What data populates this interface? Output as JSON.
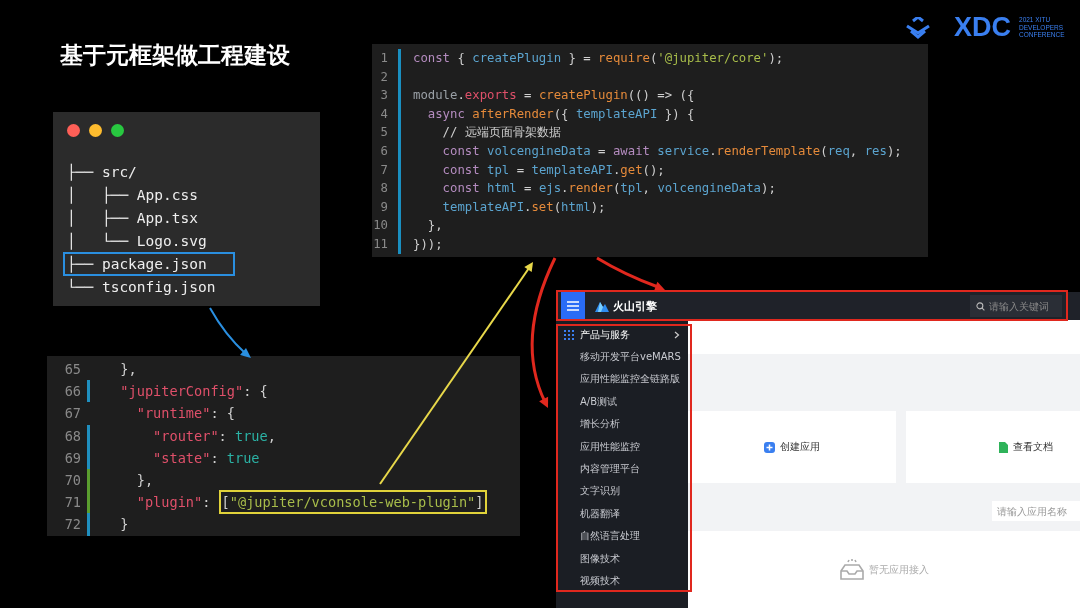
{
  "title": "基于元框架做工程建设",
  "logo": {
    "wordmark": "XDC",
    "lines": [
      "2021 XITU",
      "DEVELOPERS",
      "CONFERENCE"
    ]
  },
  "code_editor": {
    "lines": [
      {
        "number": "1",
        "tokens": [
          {
            "kind": "kw",
            "t": "const "
          },
          {
            "kind": "p",
            "t": "{ "
          },
          {
            "kind": "var",
            "t": "createPlugin"
          },
          {
            "kind": "p",
            "t": " } = "
          },
          {
            "kind": "fn",
            "t": "require"
          },
          {
            "kind": "p",
            "t": "("
          },
          {
            "kind": "str",
            "t": "'@jupiter/core'"
          },
          {
            "kind": "p",
            "t": ");"
          }
        ]
      },
      {
        "number": "2"
      },
      {
        "number": "3",
        "tokens": [
          {
            "kind": "plain",
            "t": "module"
          },
          {
            "kind": "p",
            "t": "."
          },
          {
            "kind": "prop",
            "t": "exports"
          },
          {
            "kind": "p",
            "t": " = "
          },
          {
            "kind": "fn",
            "t": "createPlugin"
          },
          {
            "kind": "p",
            "t": "(() => ({"
          }
        ]
      },
      {
        "number": "4",
        "tokens": [
          {
            "kind": "kw",
            "t": "  async "
          },
          {
            "kind": "fn",
            "t": "afterRender"
          },
          {
            "kind": "p",
            "t": "({ "
          },
          {
            "kind": "var",
            "t": "templateAPI"
          },
          {
            "kind": "p",
            "t": " }) {"
          }
        ]
      },
      {
        "number": "5",
        "tokens": [
          {
            "kind": "cmt",
            "t": "    // 远端页面骨架数据"
          }
        ]
      },
      {
        "number": "6",
        "tokens": [
          {
            "kind": "kw",
            "t": "    const "
          },
          {
            "kind": "var",
            "t": "volcengineData"
          },
          {
            "kind": "p",
            "t": " = "
          },
          {
            "kind": "kw",
            "t": "await "
          },
          {
            "kind": "var",
            "t": "service"
          },
          {
            "kind": "p",
            "t": "."
          },
          {
            "kind": "fn",
            "t": "renderTemplate"
          },
          {
            "kind": "p",
            "t": "("
          },
          {
            "kind": "var",
            "t": "req"
          },
          {
            "kind": "p",
            "t": ", "
          },
          {
            "kind": "var",
            "t": "res"
          },
          {
            "kind": "p",
            "t": ");"
          }
        ]
      },
      {
        "number": "7",
        "tokens": [
          {
            "kind": "kw",
            "t": "    const "
          },
          {
            "kind": "var",
            "t": "tpl"
          },
          {
            "kind": "p",
            "t": " = "
          },
          {
            "kind": "var",
            "t": "templateAPI"
          },
          {
            "kind": "p",
            "t": "."
          },
          {
            "kind": "fn",
            "t": "get"
          },
          {
            "kind": "p",
            "t": "();"
          }
        ]
      },
      {
        "number": "8",
        "tokens": [
          {
            "kind": "kw",
            "t": "    const "
          },
          {
            "kind": "var",
            "t": "html"
          },
          {
            "kind": "p",
            "t": " = "
          },
          {
            "kind": "var",
            "t": "ejs"
          },
          {
            "kind": "p",
            "t": "."
          },
          {
            "kind": "fn",
            "t": "render"
          },
          {
            "kind": "p",
            "t": "("
          },
          {
            "kind": "var",
            "t": "tpl"
          },
          {
            "kind": "p",
            "t": ", "
          },
          {
            "kind": "var",
            "t": "volcengineData"
          },
          {
            "kind": "p",
            "t": ");"
          }
        ]
      },
      {
        "number": "9",
        "tokens": [
          {
            "kind": "var",
            "t": "    templateAPI"
          },
          {
            "kind": "p",
            "t": "."
          },
          {
            "kind": "fn",
            "t": "set"
          },
          {
            "kind": "p",
            "t": "("
          },
          {
            "kind": "var",
            "t": "html"
          },
          {
            "kind": "p",
            "t": ");"
          }
        ]
      },
      {
        "number": "10",
        "tokens": [
          {
            "kind": "p",
            "t": "  },"
          }
        ]
      },
      {
        "number": "11",
        "tokens": [
          {
            "kind": "p",
            "t": "}));"
          }
        ]
      }
    ]
  },
  "file_tree": {
    "lines": [
      {
        "text": "├── src/",
        "boxed": false
      },
      {
        "text": "│   ├── App.css",
        "boxed": false
      },
      {
        "text": "│   ├── App.tsx",
        "boxed": false
      },
      {
        "text": "│   └── Logo.svg",
        "boxed": false
      },
      {
        "text": "├── package.json",
        "boxed": true
      },
      {
        "text": "└── tsconfig.json",
        "boxed": false
      }
    ]
  },
  "config_editor": {
    "lines": [
      {
        "number": "65",
        "tokens": [
          {
            "kind": "p",
            "t": "  },"
          }
        ]
      },
      {
        "number": "66",
        "color": "#1f8fbf",
        "tokens": [
          {
            "kind": "key",
            "t": "  \"jupiterConfig\""
          },
          {
            "kind": "p",
            "t": ": {"
          }
        ]
      },
      {
        "number": "67",
        "tokens": [
          {
            "kind": "key",
            "t": "    \"runtime\""
          },
          {
            "kind": "p",
            "t": ": {"
          }
        ]
      },
      {
        "number": "68",
        "color": "#1f8fbf",
        "tokens": [
          {
            "kind": "key",
            "t": "      \"router\""
          },
          {
            "kind": "p",
            "t": ": "
          },
          {
            "kind": "bool",
            "t": "true"
          },
          {
            "kind": "p",
            "t": ","
          }
        ]
      },
      {
        "number": "69",
        "color": "#1f8fbf",
        "tokens": [
          {
            "kind": "key",
            "t": "      \"state\""
          },
          {
            "kind": "p",
            "t": ": "
          },
          {
            "kind": "bool",
            "t": "true"
          }
        ]
      },
      {
        "number": "70",
        "color": "#5a9e2f",
        "tokens": [
          {
            "kind": "p",
            "t": "    },"
          }
        ]
      },
      {
        "number": "71",
        "color": "#5a9e2f",
        "tokens": [
          {
            "kind": "key",
            "t": "    \"plugin\""
          },
          {
            "kind": "p",
            "t": ": "
          },
          {
            "kind": "p",
            "t": "[",
            "boxed": true
          },
          {
            "kind": "str",
            "t": "\"@jupiter/vconsole-web-plugin\"",
            "boxed": true
          },
          {
            "kind": "p",
            "t": "]",
            "boxed": true
          }
        ]
      },
      {
        "number": "72",
        "color": "#1f8fbf",
        "tokens": [
          {
            "kind": "p",
            "t": "  }"
          }
        ]
      }
    ]
  },
  "web_console": {
    "brand": "火山引擎",
    "search_placeholder": "请输入关键词",
    "menu_title": "产品与服务",
    "menu_items": [
      "移动开发平台veMARS",
      "应用性能监控全链路版",
      "A/B测试",
      "增长分析",
      "应用性能监控",
      "内容管理平台",
      "文字识别",
      "机器翻译",
      "自然语言处理",
      "图像技术",
      "视频技术"
    ],
    "cards": [
      {
        "kind": "create",
        "label": "创建应用"
      },
      {
        "kind": "docs",
        "label": "查看文档"
      }
    ],
    "app_search_placeholder": "请输入应用名称",
    "empty_text": "暂无应用接入"
  }
}
